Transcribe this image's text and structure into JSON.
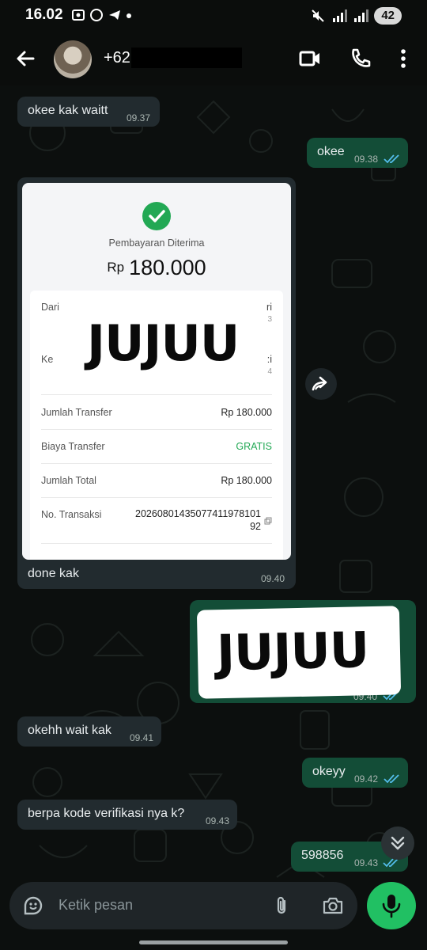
{
  "status_bar": {
    "time": "16.02",
    "battery": "42"
  },
  "header": {
    "contact_name": "+62"
  },
  "messages": [
    {
      "text": "okee kak waitt",
      "time": "09.37",
      "dir": "in"
    },
    {
      "text": "okee",
      "time": "09.38",
      "dir": "out"
    },
    {
      "caption": "done kak",
      "time": "09.40",
      "dir": "in"
    },
    {
      "time": "09.40",
      "dir": "out"
    },
    {
      "text": "okehh wait kak",
      "time": "09.41",
      "dir": "in"
    },
    {
      "text": "okeyy",
      "time": "09.42",
      "dir": "out"
    },
    {
      "text": "berpa kode verifikasi nya k?",
      "time": "09.43",
      "dir": "in"
    },
    {
      "text": "598856",
      "time": "09.43",
      "dir": "out"
    }
  ],
  "receipt": {
    "title": "Pembayaran Diterima",
    "currency": "Rp",
    "amount": "180.000",
    "rows": [
      {
        "label": "Dari",
        "value": ""
      },
      {
        "label": "Ke",
        "value": ""
      },
      {
        "label": "Jumlah Transfer",
        "value": "Rp 180.000"
      },
      {
        "label": "Biaya Transfer",
        "value": "GRATIS"
      },
      {
        "label": "Jumlah Total",
        "value": "Rp 180.000"
      },
      {
        "label": "No. Transaksi",
        "value_line1": "202608014350774119781​01",
        "value_line2": "92"
      }
    ],
    "watermark": "JUJUU"
  },
  "image_message": {
    "watermark": "JUJUU"
  },
  "input": {
    "placeholder": "Ketik pesan"
  },
  "colors": {
    "accent": "#21c063",
    "outgoing_bubble": "#134d37",
    "incoming_bubble": "#222b2f",
    "read_ticks": "#53bdeb"
  },
  "icons": [
    "back-arrow-icon",
    "video-call-icon",
    "phone-icon",
    "more-vert-icon",
    "forward-icon",
    "sticker-icon",
    "attach-icon",
    "camera-icon",
    "mic-icon",
    "double-chevron-down-icon",
    "double-check-icon",
    "check-icon"
  ]
}
